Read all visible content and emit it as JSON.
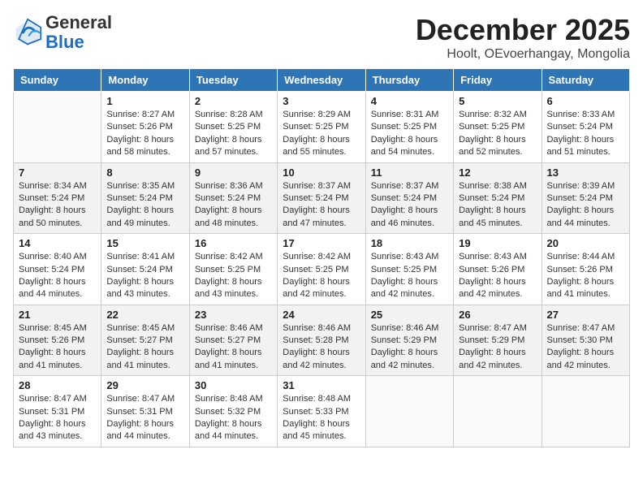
{
  "logo": {
    "general": "General",
    "blue": "Blue"
  },
  "header": {
    "title": "December 2025",
    "subtitle": "Hoolt, OEvoerhangay, Mongolia"
  },
  "weekdays": [
    "Sunday",
    "Monday",
    "Tuesday",
    "Wednesday",
    "Thursday",
    "Friday",
    "Saturday"
  ],
  "weeks": [
    [
      {
        "day": "",
        "info": ""
      },
      {
        "day": "1",
        "info": "Sunrise: 8:27 AM\nSunset: 5:26 PM\nDaylight: 8 hours\nand 58 minutes."
      },
      {
        "day": "2",
        "info": "Sunrise: 8:28 AM\nSunset: 5:25 PM\nDaylight: 8 hours\nand 57 minutes."
      },
      {
        "day": "3",
        "info": "Sunrise: 8:29 AM\nSunset: 5:25 PM\nDaylight: 8 hours\nand 55 minutes."
      },
      {
        "day": "4",
        "info": "Sunrise: 8:31 AM\nSunset: 5:25 PM\nDaylight: 8 hours\nand 54 minutes."
      },
      {
        "day": "5",
        "info": "Sunrise: 8:32 AM\nSunset: 5:25 PM\nDaylight: 8 hours\nand 52 minutes."
      },
      {
        "day": "6",
        "info": "Sunrise: 8:33 AM\nSunset: 5:24 PM\nDaylight: 8 hours\nand 51 minutes."
      }
    ],
    [
      {
        "day": "7",
        "info": "Sunrise: 8:34 AM\nSunset: 5:24 PM\nDaylight: 8 hours\nand 50 minutes."
      },
      {
        "day": "8",
        "info": "Sunrise: 8:35 AM\nSunset: 5:24 PM\nDaylight: 8 hours\nand 49 minutes."
      },
      {
        "day": "9",
        "info": "Sunrise: 8:36 AM\nSunset: 5:24 PM\nDaylight: 8 hours\nand 48 minutes."
      },
      {
        "day": "10",
        "info": "Sunrise: 8:37 AM\nSunset: 5:24 PM\nDaylight: 8 hours\nand 47 minutes."
      },
      {
        "day": "11",
        "info": "Sunrise: 8:37 AM\nSunset: 5:24 PM\nDaylight: 8 hours\nand 46 minutes."
      },
      {
        "day": "12",
        "info": "Sunrise: 8:38 AM\nSunset: 5:24 PM\nDaylight: 8 hours\nand 45 minutes."
      },
      {
        "day": "13",
        "info": "Sunrise: 8:39 AM\nSunset: 5:24 PM\nDaylight: 8 hours\nand 44 minutes."
      }
    ],
    [
      {
        "day": "14",
        "info": "Sunrise: 8:40 AM\nSunset: 5:24 PM\nDaylight: 8 hours\nand 44 minutes."
      },
      {
        "day": "15",
        "info": "Sunrise: 8:41 AM\nSunset: 5:24 PM\nDaylight: 8 hours\nand 43 minutes."
      },
      {
        "day": "16",
        "info": "Sunrise: 8:42 AM\nSunset: 5:25 PM\nDaylight: 8 hours\nand 43 minutes."
      },
      {
        "day": "17",
        "info": "Sunrise: 8:42 AM\nSunset: 5:25 PM\nDaylight: 8 hours\nand 42 minutes."
      },
      {
        "day": "18",
        "info": "Sunrise: 8:43 AM\nSunset: 5:25 PM\nDaylight: 8 hours\nand 42 minutes."
      },
      {
        "day": "19",
        "info": "Sunrise: 8:43 AM\nSunset: 5:26 PM\nDaylight: 8 hours\nand 42 minutes."
      },
      {
        "day": "20",
        "info": "Sunrise: 8:44 AM\nSunset: 5:26 PM\nDaylight: 8 hours\nand 41 minutes."
      }
    ],
    [
      {
        "day": "21",
        "info": "Sunrise: 8:45 AM\nSunset: 5:26 PM\nDaylight: 8 hours\nand 41 minutes."
      },
      {
        "day": "22",
        "info": "Sunrise: 8:45 AM\nSunset: 5:27 PM\nDaylight: 8 hours\nand 41 minutes."
      },
      {
        "day": "23",
        "info": "Sunrise: 8:46 AM\nSunset: 5:27 PM\nDaylight: 8 hours\nand 41 minutes."
      },
      {
        "day": "24",
        "info": "Sunrise: 8:46 AM\nSunset: 5:28 PM\nDaylight: 8 hours\nand 42 minutes."
      },
      {
        "day": "25",
        "info": "Sunrise: 8:46 AM\nSunset: 5:29 PM\nDaylight: 8 hours\nand 42 minutes."
      },
      {
        "day": "26",
        "info": "Sunrise: 8:47 AM\nSunset: 5:29 PM\nDaylight: 8 hours\nand 42 minutes."
      },
      {
        "day": "27",
        "info": "Sunrise: 8:47 AM\nSunset: 5:30 PM\nDaylight: 8 hours\nand 42 minutes."
      }
    ],
    [
      {
        "day": "28",
        "info": "Sunrise: 8:47 AM\nSunset: 5:31 PM\nDaylight: 8 hours\nand 43 minutes."
      },
      {
        "day": "29",
        "info": "Sunrise: 8:47 AM\nSunset: 5:31 PM\nDaylight: 8 hours\nand 44 minutes."
      },
      {
        "day": "30",
        "info": "Sunrise: 8:48 AM\nSunset: 5:32 PM\nDaylight: 8 hours\nand 44 minutes."
      },
      {
        "day": "31",
        "info": "Sunrise: 8:48 AM\nSunset: 5:33 PM\nDaylight: 8 hours\nand 45 minutes."
      },
      {
        "day": "",
        "info": ""
      },
      {
        "day": "",
        "info": ""
      },
      {
        "day": "",
        "info": ""
      }
    ]
  ]
}
